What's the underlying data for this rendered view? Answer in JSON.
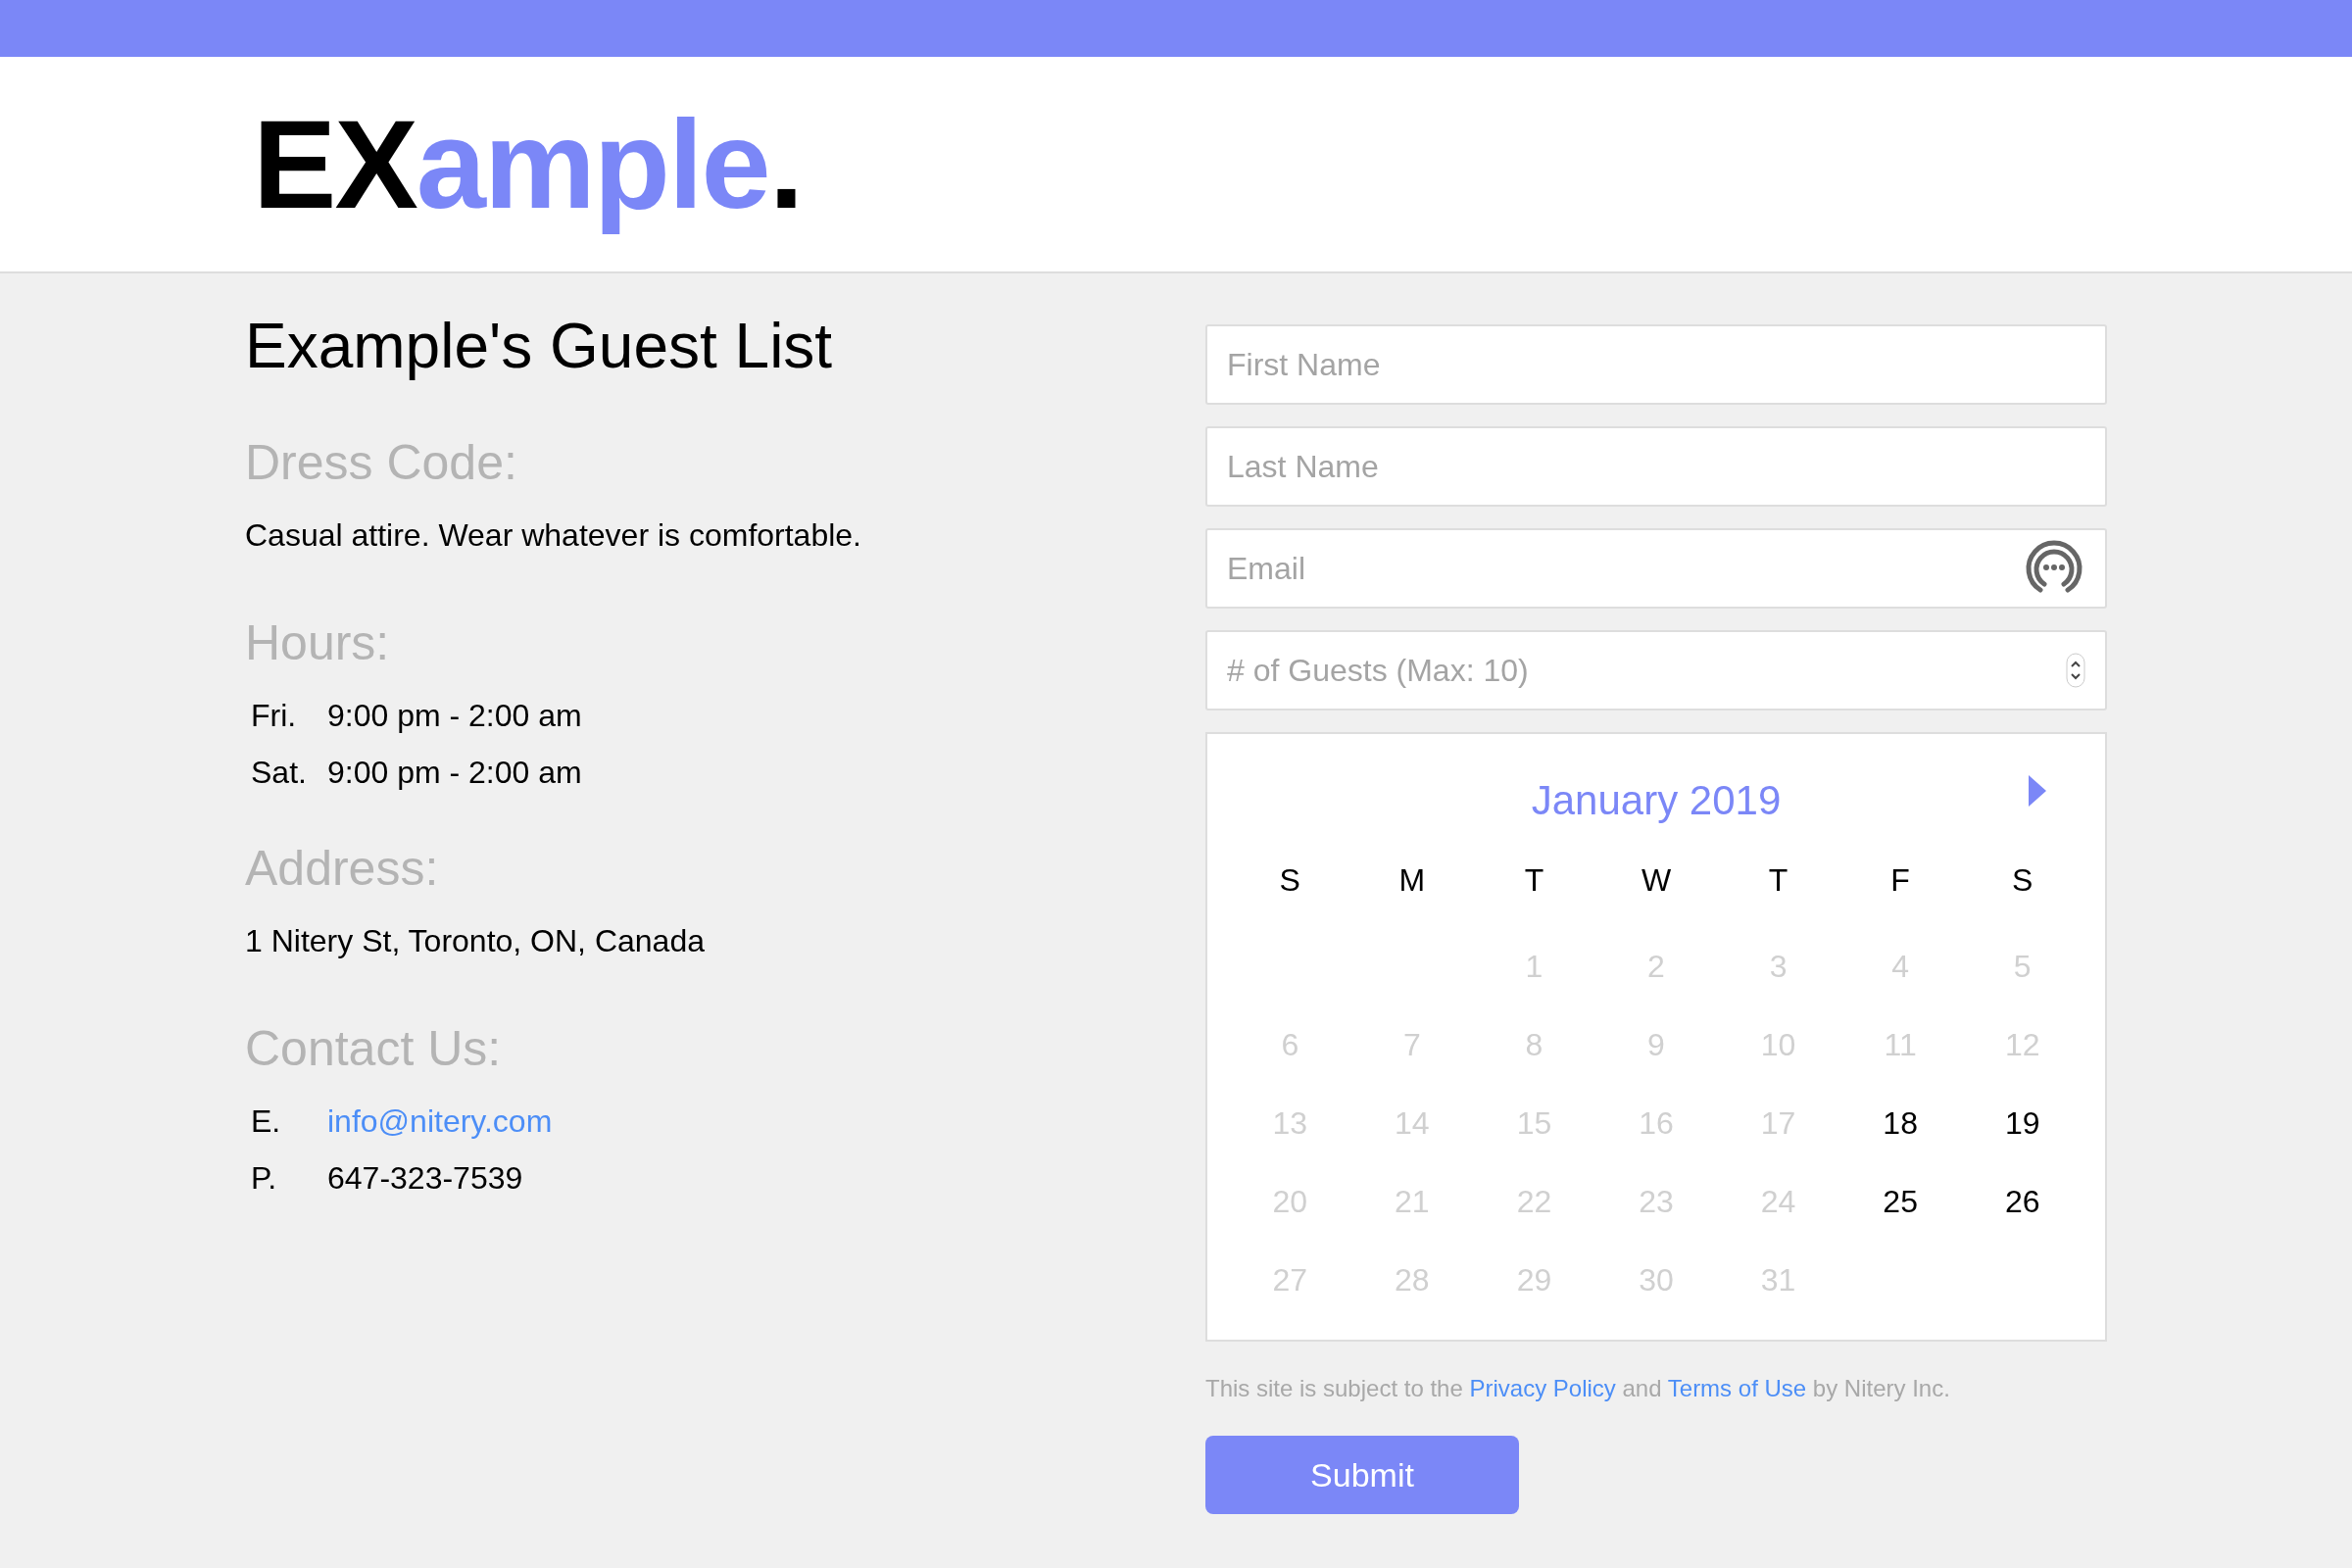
{
  "logo": [
    {
      "text": "EX",
      "color": "#000000"
    },
    {
      "text": "ample",
      "color": "#7b87f7"
    },
    {
      "text": ".",
      "color": "#000000"
    }
  ],
  "title": "Example's Guest List",
  "dress_code": {
    "heading": "Dress Code:",
    "text": "Casual attire. Wear whatever is comfortable."
  },
  "hours": {
    "heading": "Hours:",
    "rows": [
      {
        "day": "Fri.",
        "time": "9:00 pm - 2:00 am"
      },
      {
        "day": "Sat.",
        "time": "9:00 pm - 2:00 am"
      }
    ]
  },
  "address": {
    "heading": "Address:",
    "text": "1 Nitery St, Toronto, ON, Canada"
  },
  "contact": {
    "heading": "Contact Us:",
    "rows": [
      {
        "label": "E.",
        "value": "info@nitery.com",
        "kind": "link"
      },
      {
        "label": "P.",
        "value": "647-323-7539",
        "kind": "text"
      }
    ]
  },
  "form": {
    "fields": [
      {
        "placeholder": "First Name",
        "kind": "text"
      },
      {
        "placeholder": "Last Name",
        "kind": "text"
      },
      {
        "placeholder": "Email",
        "kind": "email"
      },
      {
        "placeholder": "# of Guests (Max: 10)",
        "kind": "number"
      }
    ]
  },
  "calendar": {
    "month": "January 2019",
    "weekdays": [
      "S",
      "M",
      "T",
      "W",
      "T",
      "F",
      "S"
    ],
    "weeks": [
      [
        {
          "kind": "blank"
        },
        {
          "kind": "blank"
        },
        {
          "kind": "day",
          "day": "1",
          "available": false
        },
        {
          "kind": "day",
          "day": "2",
          "available": false
        },
        {
          "kind": "day",
          "day": "3",
          "available": false
        },
        {
          "kind": "day",
          "day": "4",
          "available": false
        },
        {
          "kind": "day",
          "day": "5",
          "available": false
        }
      ],
      [
        {
          "kind": "day",
          "day": "6",
          "available": false
        },
        {
          "kind": "day",
          "day": "7",
          "available": false
        },
        {
          "kind": "day",
          "day": "8",
          "available": false
        },
        {
          "kind": "day",
          "day": "9",
          "available": false
        },
        {
          "kind": "day",
          "day": "10",
          "available": false
        },
        {
          "kind": "day",
          "day": "11",
          "available": false
        },
        {
          "kind": "day",
          "day": "12",
          "available": false
        }
      ],
      [
        {
          "kind": "day",
          "day": "13",
          "available": false
        },
        {
          "kind": "day",
          "day": "14",
          "available": false
        },
        {
          "kind": "day",
          "day": "15",
          "available": false
        },
        {
          "kind": "day",
          "day": "16",
          "available": false
        },
        {
          "kind": "day",
          "day": "17",
          "available": false
        },
        {
          "kind": "day",
          "day": "18",
          "available": true
        },
        {
          "kind": "day",
          "day": "19",
          "available": true
        }
      ],
      [
        {
          "kind": "day",
          "day": "20",
          "available": false
        },
        {
          "kind": "day",
          "day": "21",
          "available": false
        },
        {
          "kind": "day",
          "day": "22",
          "available": false
        },
        {
          "kind": "day",
          "day": "23",
          "available": false
        },
        {
          "kind": "day",
          "day": "24",
          "available": false
        },
        {
          "kind": "day",
          "day": "25",
          "available": true
        },
        {
          "kind": "day",
          "day": "26",
          "available": true
        }
      ],
      [
        {
          "kind": "day",
          "day": "27",
          "available": false
        },
        {
          "kind": "day",
          "day": "28",
          "available": false
        },
        {
          "kind": "day",
          "day": "29",
          "available": false
        },
        {
          "kind": "day",
          "day": "30",
          "available": false
        },
        {
          "kind": "day",
          "day": "31",
          "available": false
        },
        {
          "kind": "blank"
        },
        {
          "kind": "blank"
        }
      ]
    ]
  },
  "legal": [
    {
      "kind": "text",
      "text": "This site is subject to the"
    },
    {
      "kind": "link",
      "text": "Privacy Policy"
    },
    {
      "kind": "text",
      "text": "and"
    },
    {
      "kind": "link",
      "text": "Terms of Use"
    },
    {
      "kind": "text",
      "text": "by Nitery Inc."
    }
  ],
  "submit": "Submit"
}
